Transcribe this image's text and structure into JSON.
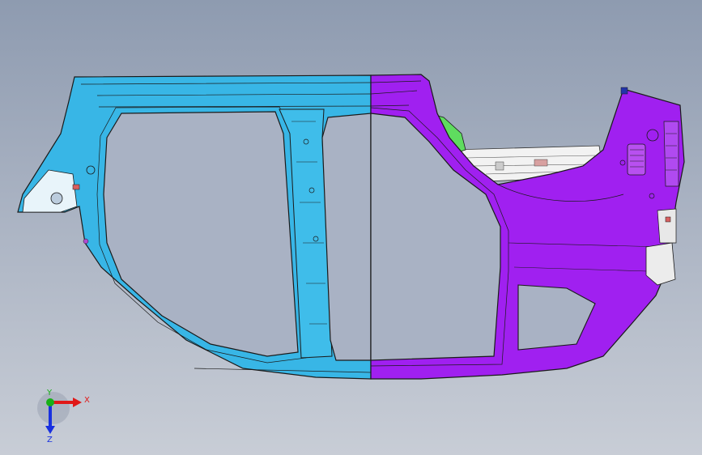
{
  "triad": {
    "x_label": "X",
    "y_label": "Y",
    "z_label": "Z"
  },
  "colors": {
    "background_top": "#8e9bb0",
    "background_bottom": "#c8cdd6",
    "front_section": "#38b6e6",
    "rear_section": "#a020f0",
    "green_bracket": "#5fdc5f",
    "edge": "#1a1a1a",
    "axis_x": "#e01818",
    "axis_y": "#18b018",
    "axis_z": "#1830e0"
  },
  "model": {
    "part": "body-side-outer-panel"
  }
}
